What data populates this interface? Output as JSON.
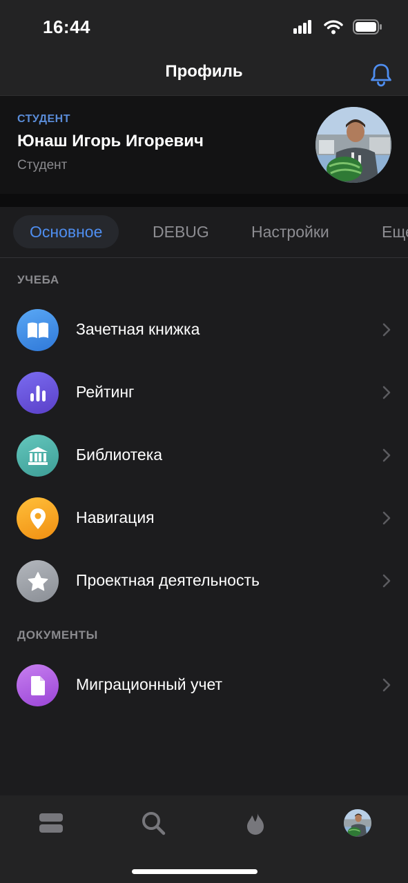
{
  "status_bar": {
    "time": "16:44",
    "icons": [
      "cellular-signal-icon",
      "wifi-icon",
      "battery-icon"
    ]
  },
  "header": {
    "title": "Профиль",
    "icon": "bell-icon"
  },
  "profile": {
    "role": "СТУДЕНТ",
    "name": "Юнаш Игорь Игоревич",
    "subtitle": "Студент",
    "avatar": "user-avatar-photo"
  },
  "tabs": [
    {
      "label": "Основное",
      "active": true
    },
    {
      "label": "DEBUG",
      "active": false
    },
    {
      "label": "Настройки",
      "active": false
    },
    {
      "label": "Еще",
      "active": false
    }
  ],
  "sections": [
    {
      "title": "УЧЕБА",
      "items": [
        {
          "label": "Зачетная книжка",
          "icon": "book-icon",
          "color": "#3d8fe8"
        },
        {
          "label": "Рейтинг",
          "icon": "bar-chart-icon",
          "color": "#6b55d8"
        },
        {
          "label": "Библиотека",
          "icon": "library-icon",
          "color": "#4fb5ae"
        },
        {
          "label": "Навигация",
          "icon": "location-pin-icon",
          "color": "#f5a623"
        },
        {
          "label": "Проектная деятельность",
          "icon": "star-icon",
          "color": "#9ea2a8"
        }
      ]
    },
    {
      "title": "ДОКУМЕНТЫ",
      "items": [
        {
          "label": "Миграционный учет",
          "icon": "document-icon",
          "color": "#b35fe0"
        }
      ]
    }
  ],
  "tab_bar": {
    "items": [
      "feed-icon",
      "search-icon",
      "flame-icon",
      "profile-avatar"
    ]
  },
  "colors": {
    "accent": "#4f8ef0",
    "background": "#1c1c1e",
    "card": "#131314",
    "bar": "#232324"
  }
}
